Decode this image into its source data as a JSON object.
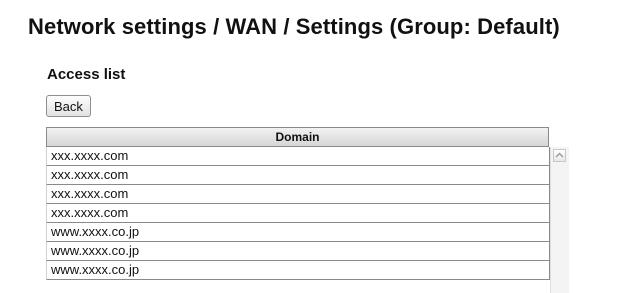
{
  "page": {
    "title": "Network settings / WAN / Settings (Group: Default)"
  },
  "access_list": {
    "heading": "Access list",
    "back_label": "Back",
    "column_header": "Domain",
    "rows": [
      "xxx.xxxx.com",
      "xxx.xxxx.com",
      "xxx.xxxx.com",
      "xxx.xxxx.com",
      "www.xxxx.co.jp",
      "www.xxxx.co.jp",
      "www.xxxx.co.jp"
    ]
  },
  "icons": {
    "scroll_up": "chevron-up-icon"
  }
}
